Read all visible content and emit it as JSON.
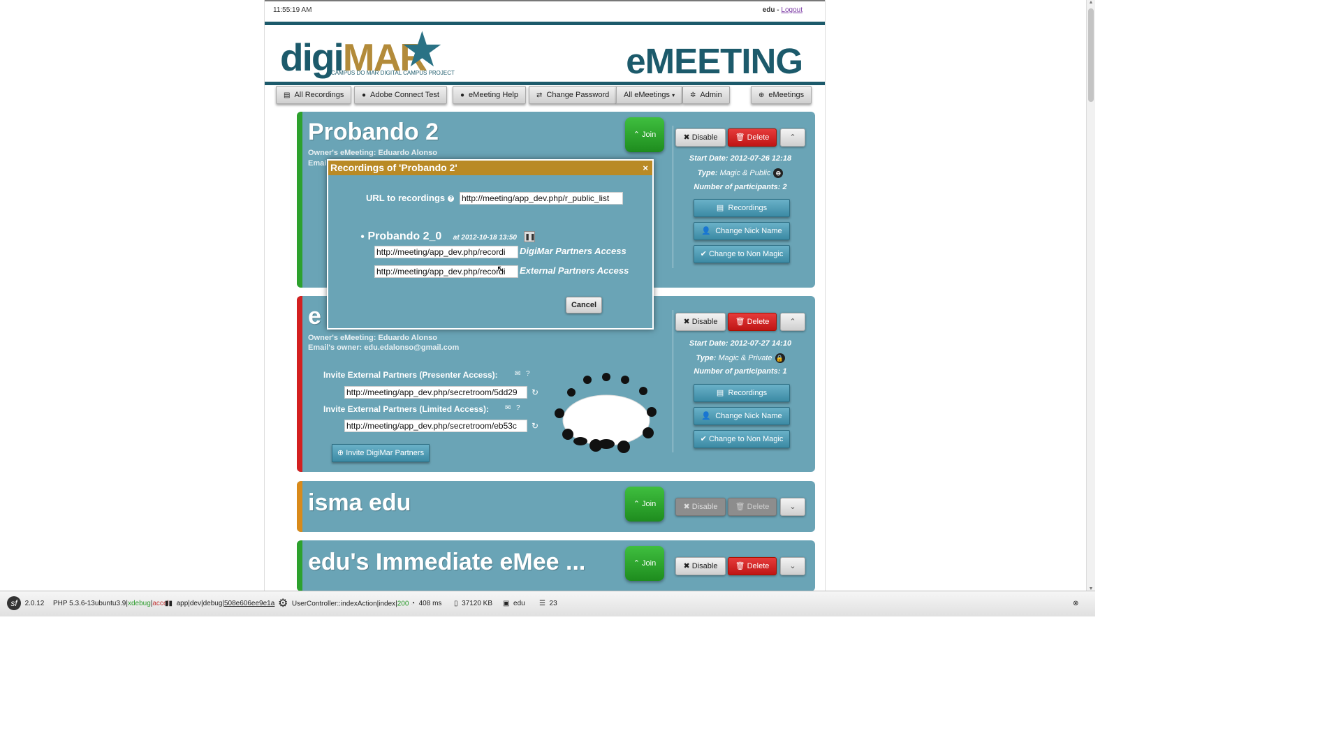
{
  "header": {
    "clock": "11:55:19 AM",
    "user": "edu",
    "user_sep": " - ",
    "logout": "Logout",
    "logo_digi": "digi",
    "logo_mar": "MAR",
    "logo_sub": "CAMPUS DO MAR DIGITAL CAMPUS PROJECT",
    "brand": "eMEETING"
  },
  "nav": {
    "all_recordings": "All Recordings",
    "adobe_test": "Adobe Connect Test",
    "help": "eMeeting Help",
    "change_password": "Change Password",
    "all_emeetings": "All eMeetings",
    "admin": "Admin",
    "emeetings": "eMeetings"
  },
  "meetings": [
    {
      "title": "Probando 2",
      "owner": "Owner's eMeeting: Eduardo Alonso",
      "email_prefix": "Emai",
      "status_color": "#2da12d",
      "join": "Join",
      "disable": "Disable",
      "delete": "Delete",
      "start": "Start Date: 2012-07-26 12:18",
      "type_label": "Type:",
      "type": "Magic & Public",
      "participants": "Number of participants: 2",
      "recordings": "Recordings",
      "nick": "Change Nick Name",
      "non_magic": "Change to Non Magic"
    },
    {
      "title": "e",
      "owner": "Owner's eMeeting: Eduardo Alonso",
      "email": "Email's owner: edu.edalonso@gmail.com",
      "status_color": "#d32020",
      "disable": "Disable",
      "delete": "Delete",
      "start": "Start Date: 2012-07-27 14:10",
      "type_label": "Type:",
      "type": "Magic & Private",
      "participants": "Number of participants: 1",
      "recordings": "Recordings",
      "nick": "Change Nick Name",
      "non_magic": "Change to Non Magic",
      "invite_presenter_label": "Invite External Partners (Presenter Access):",
      "invite_presenter_url": "http://meeting/app_dev.php/secretroom/5dd29",
      "invite_limited_label": "Invite External Partners (Limited Access):",
      "invite_limited_url": "http://meeting/app_dev.php/secretroom/eb53c",
      "invite_digimar": "Invite DigiMar Partners"
    },
    {
      "title": "isma edu",
      "status_color": "#d98a1a",
      "join": "Join",
      "disable": "Disable",
      "delete": "Delete"
    },
    {
      "title": "edu's Immediate eMee ...",
      "status_color": "#2da12d",
      "join": "Join",
      "disable": "Disable",
      "delete": "Delete"
    }
  ],
  "modal": {
    "title": "Recordings of 'Probando 2'",
    "close": "×",
    "url_label": "URL to recordings",
    "url_value": "http://meeting/app_dev.php/r_public_list",
    "recording_name": "Probando 2_0",
    "recording_at": "at 2012-10-18 13:50",
    "digimar_url": "http://meeting/app_dev.php/recordi",
    "digimar_label": "DigiMar Partners Access",
    "external_url": "http://meeting/app_dev.php/recordi",
    "external_label": "External Partners Access",
    "cancel": "Cancel"
  },
  "toolbar": {
    "symfony_version": "2.0.12",
    "php": "PHP 5.3.6-13ubuntu3.9",
    "xdebug": "xdebug",
    "accel": "accel",
    "env": "app|dev|debug|",
    "token": "508e606ee9e1a",
    "controller": "UserController::indexAction|index|",
    "status": "200",
    "time": "408 ms",
    "memory": "37120 KB",
    "user": "edu",
    "queries": "23"
  },
  "colors": {
    "brand_dark": "#1c5a6b",
    "brand_gold": "#b38b3a",
    "card_bg": "#6aa4b6",
    "modal_title": "#b98a25",
    "join_green": "#2da12d",
    "delete_red": "#d32020"
  }
}
